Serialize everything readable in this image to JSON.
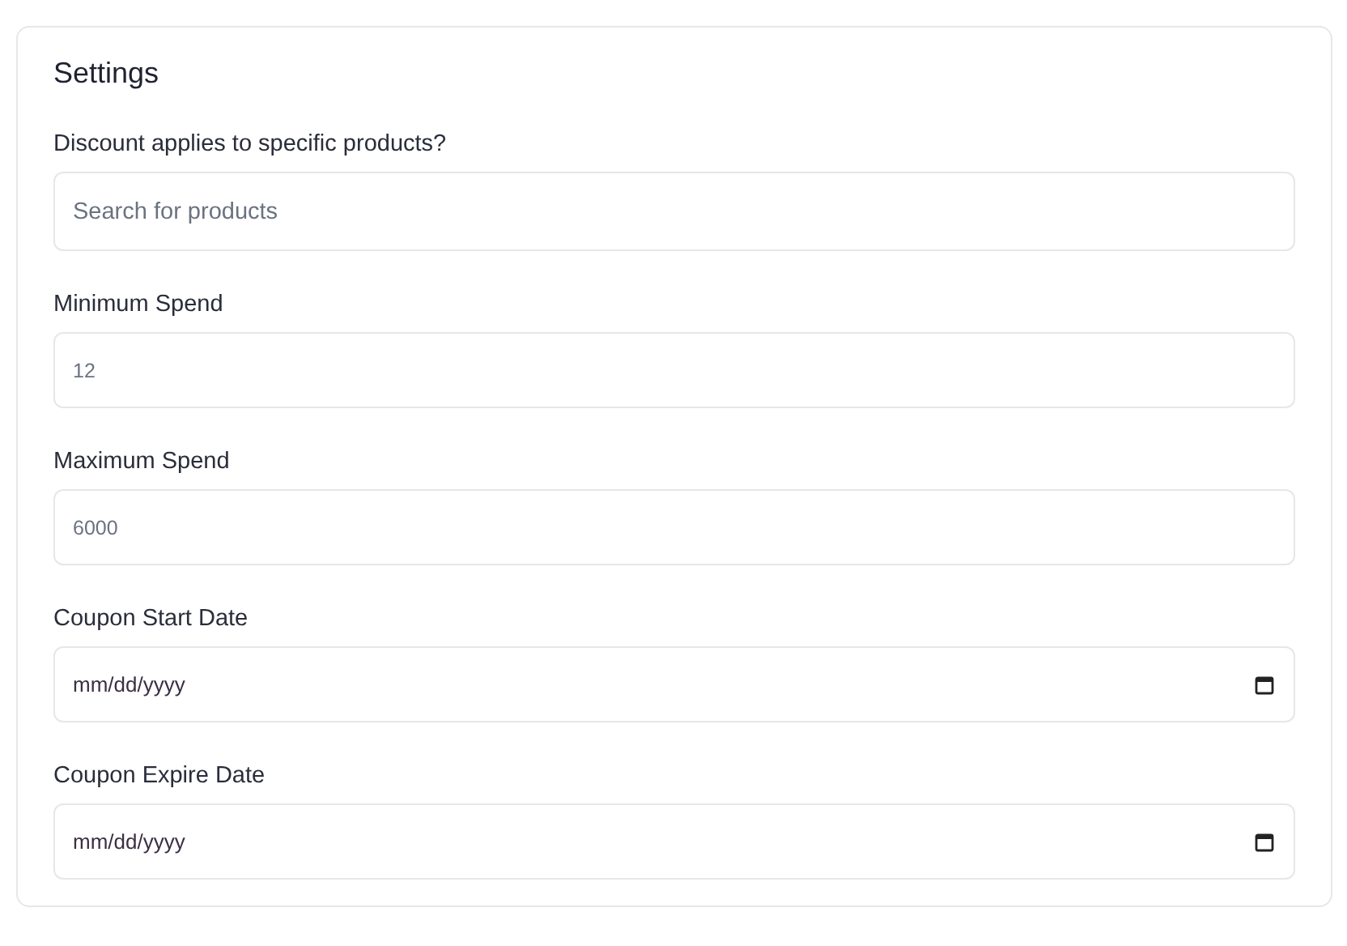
{
  "card": {
    "title": "Settings"
  },
  "fields": [
    {
      "kind": "text",
      "label": "Discount applies to specific products?",
      "placeholder": "Search for products"
    },
    {
      "kind": "number",
      "label": "Minimum Spend",
      "placeholder": "12"
    },
    {
      "kind": "number",
      "label": "Maximum Spend",
      "placeholder": "6000"
    },
    {
      "kind": "date",
      "label": "Coupon Start Date",
      "placeholder": "mm/dd/yyyy"
    },
    {
      "kind": "date",
      "label": "Coupon Expire Date",
      "placeholder": "mm/dd/yyyy"
    }
  ]
}
